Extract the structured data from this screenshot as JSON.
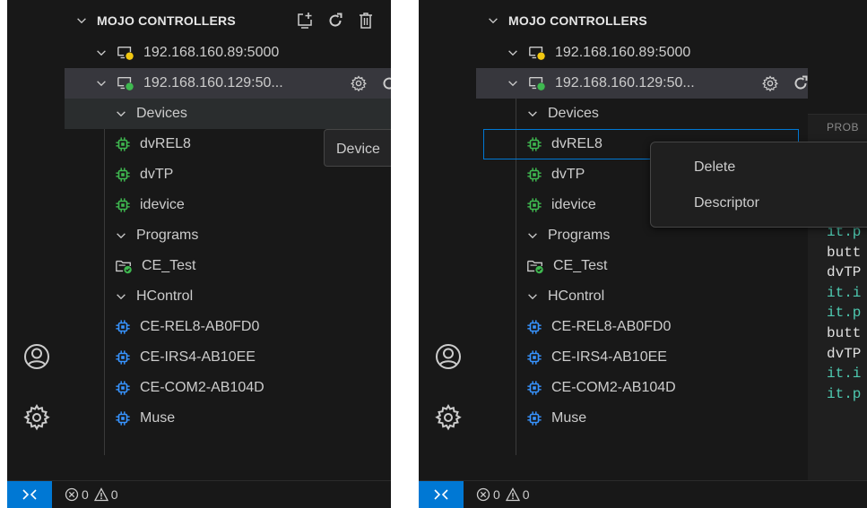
{
  "colors": {
    "background": "#181818",
    "editor": "#1f1f1f",
    "selection": "#37373d",
    "focus_border": "#0078d4",
    "remote_button": "#0078d4",
    "status_online": "#3fb950",
    "status_warning": "#f2c811",
    "chip_green": "#3fb950",
    "chip_blue": "#3794ff",
    "code_teal": "#4ec9b0"
  },
  "left": {
    "section": {
      "title": "MOJO CONTROLLERS",
      "icons": [
        "add-controller-icon",
        "refresh-icon",
        "trash-icon"
      ]
    },
    "controllers": [
      {
        "label": "192.168.160.89:5000",
        "status": "warning",
        "icon": "monitor-warning-icon"
      },
      {
        "label": "192.168.160.129:50...",
        "status": "online",
        "icon": "monitor-online-icon",
        "actions": [
          "gear-icon",
          "refresh-icon"
        ]
      }
    ],
    "groups": {
      "devices": {
        "label": "Devices",
        "items": [
          "dvREL8",
          "dvTP",
          "idevice"
        ]
      },
      "programs": {
        "label": "Programs",
        "items": [
          "CE_Test"
        ]
      },
      "hcontrol": {
        "label": "HControl",
        "items": [
          "CE-REL8-AB0FD0",
          "CE-IRS4-AB10EE",
          "CE-COM2-AB104D",
          "Muse"
        ]
      }
    },
    "tooltip": "Device",
    "status": {
      "errors": "0",
      "warnings": "0"
    }
  },
  "right": {
    "section": {
      "title": "MOJO CONTROLLERS"
    },
    "controllers": [
      {
        "label": "192.168.160.89:5000",
        "status": "warning"
      },
      {
        "label": "192.168.160.129:50...",
        "status": "online",
        "actions": [
          "gear-icon",
          "refresh-icon"
        ]
      }
    ],
    "groups": {
      "devices": {
        "label": "Devices",
        "items": [
          "dvREL8",
          "dvTP",
          "idevice"
        ]
      },
      "programs": {
        "label": "Programs",
        "items": [
          "CE_Test"
        ]
      },
      "hcontrol": {
        "label": "HControl",
        "items": [
          "CE-REL8-AB0FD0",
          "CE-IRS4-AB10EE",
          "CE-COM2-AB104D",
          "Muse"
        ]
      }
    },
    "context_menu": [
      "Delete",
      "Descriptor"
    ],
    "editor": {
      "panel_label": "PROB",
      "code": [
        "it.p",
        "butt",
        "dvTP",
        "it.i",
        "it.p",
        "butt",
        "dvTP",
        "it.i",
        "it.p"
      ]
    },
    "status": {
      "errors": "0",
      "warnings": "0"
    }
  }
}
